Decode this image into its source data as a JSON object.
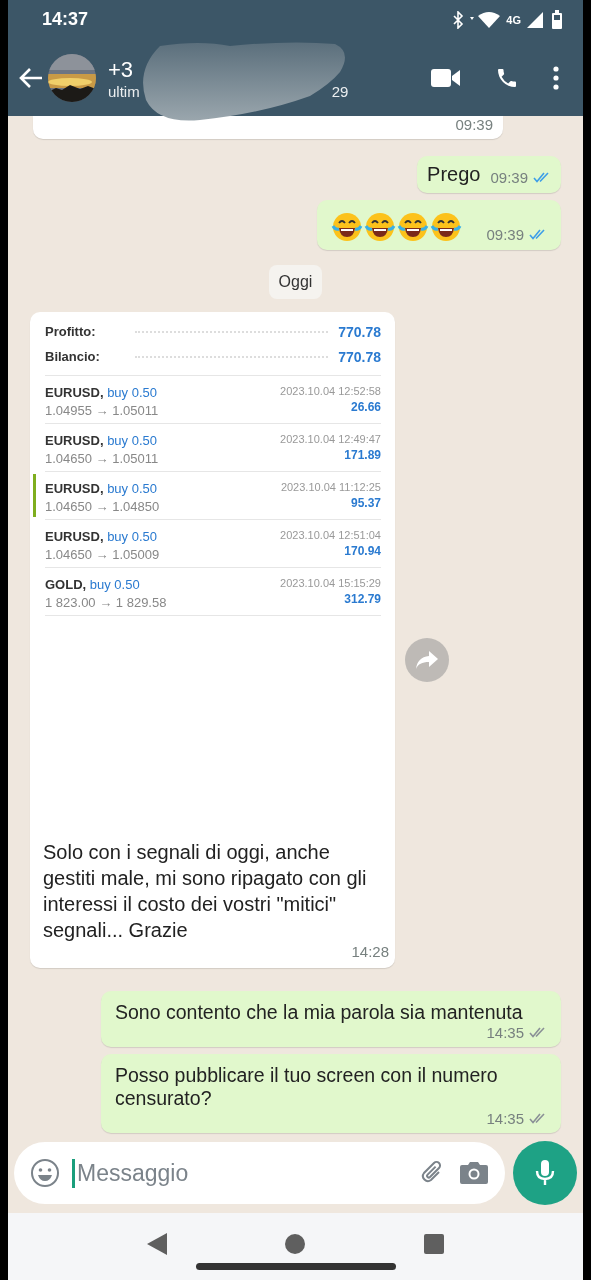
{
  "status_bar": {
    "time": "14:37",
    "network": "4G"
  },
  "header": {
    "title": "+3",
    "subtitle_start": "ultim",
    "subtitle_end": "29"
  },
  "messages": [
    {
      "kind": "partial",
      "outgoing": false,
      "time": "09:39"
    },
    {
      "kind": "text",
      "outgoing": true,
      "text": "Prego",
      "time": "09:39",
      "read": true
    },
    {
      "kind": "emoji",
      "outgoing": true,
      "emojis": [
        {
          "kind": "tears-of-joy"
        },
        {
          "kind": "tears-of-joy"
        },
        {
          "kind": "tears-of-joy"
        },
        {
          "kind": "tears-of-joy"
        }
      ],
      "time": "09:39",
      "read": true
    },
    {
      "kind": "date",
      "text": "Oggi"
    },
    {
      "outgoing": false,
      "caption": "Solo con i segnali di oggi, anche gestiti male, mi sono ripagato con gli interessi il costo dei vostri \"mitici\" segnali... Grazie",
      "time": "14:28",
      "screenshot": {
        "summary": [
          {
            "label": "Profitto:",
            "value": "770.78"
          },
          {
            "label": "Bilancio:",
            "value": "770.78"
          }
        ],
        "trades": [
          {
            "symbol": "EURUSD,",
            "action": "buy 0.50",
            "prices": "1.04955 → 1.05011",
            "date": "2023.10.04 12:52:58",
            "profit": "26.66",
            "highlighted": false
          },
          {
            "symbol": "EURUSD,",
            "action": "buy 0.50",
            "prices": "1.04650 → 1.05011",
            "date": "2023.10.04 12:49:47",
            "profit": "171.89",
            "highlighted": false
          },
          {
            "symbol": "EURUSD,",
            "action": "buy 0.50",
            "prices": "1.04650 → 1.04850",
            "date": "2023.10.04 11:12:25",
            "profit": "95.37",
            "highlighted": true
          },
          {
            "symbol": "EURUSD,",
            "action": "buy 0.50",
            "prices": "1.04650 → 1.05009",
            "date": "2023.10.04 12:51:04",
            "profit": "170.94",
            "highlighted": false
          },
          {
            "symbol": "GOLD,",
            "action": "buy 0.50",
            "prices": "1 823.00 → 1 829.58",
            "date": "2023.10.04 15:15:29",
            "profit": "312.79",
            "highlighted": false
          }
        ]
      }
    },
    {
      "kind": "text",
      "outgoing": true,
      "text": "Sono contento che la mia parola sia mantenuta",
      "time": "14:35",
      "read": false
    },
    {
      "kind": "text",
      "outgoing": true,
      "text": "Posso pubblicare il tuo screen con il numero censurato?",
      "time": "14:35",
      "read": false
    }
  ],
  "composer": {
    "placeholder": "Messaggio"
  }
}
